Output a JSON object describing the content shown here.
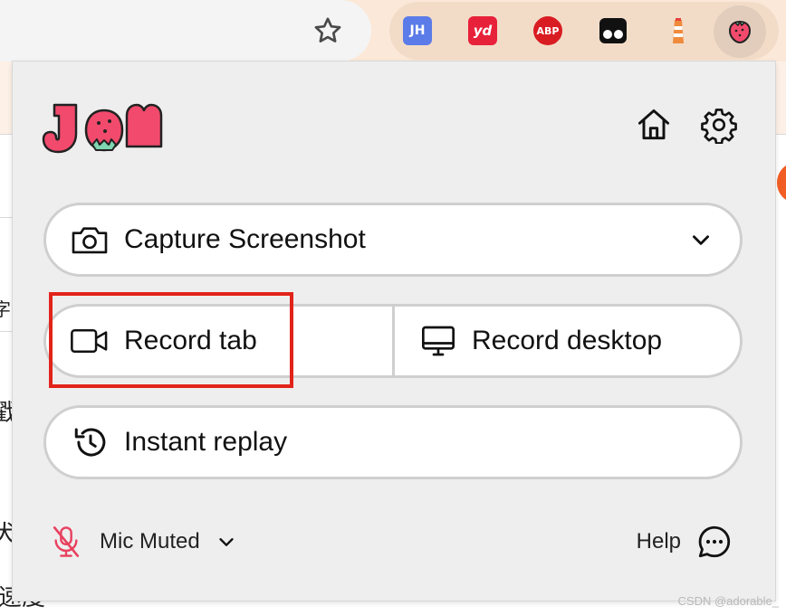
{
  "browser": {
    "extensions": [
      {
        "id": "jh",
        "text": "JH",
        "icon": "jh-extension-icon"
      },
      {
        "id": "yd",
        "text": "yd",
        "icon": "youdao-extension-icon"
      },
      {
        "id": "abp",
        "text": "ABP",
        "icon": "adblock-plus-icon"
      },
      {
        "id": "tampermonkey",
        "icon": "tampermonkey-icon"
      },
      {
        "id": "lighthouse",
        "icon": "lighthouse-icon"
      },
      {
        "id": "jam",
        "icon": "jam-strawberry-icon"
      }
    ],
    "background_text": [
      "字",
      "戳",
      "犬",
      "速度"
    ]
  },
  "popup": {
    "logo_text": "JAM",
    "capture": {
      "label": "Capture Screenshot"
    },
    "record_tab": {
      "label": "Record tab"
    },
    "record_desktop": {
      "label": "Record desktop"
    },
    "instant_replay": {
      "label": "Instant replay"
    },
    "mic": {
      "label": "Mic Muted"
    },
    "help": {
      "label": "Help"
    }
  },
  "watermark": "CSDN @adorable_",
  "colors": {
    "jam_pink": "#f24a6c",
    "highlight_red": "#e2231a",
    "popup_bg": "#eeeeee",
    "pill_border": "#cfcfcf"
  }
}
